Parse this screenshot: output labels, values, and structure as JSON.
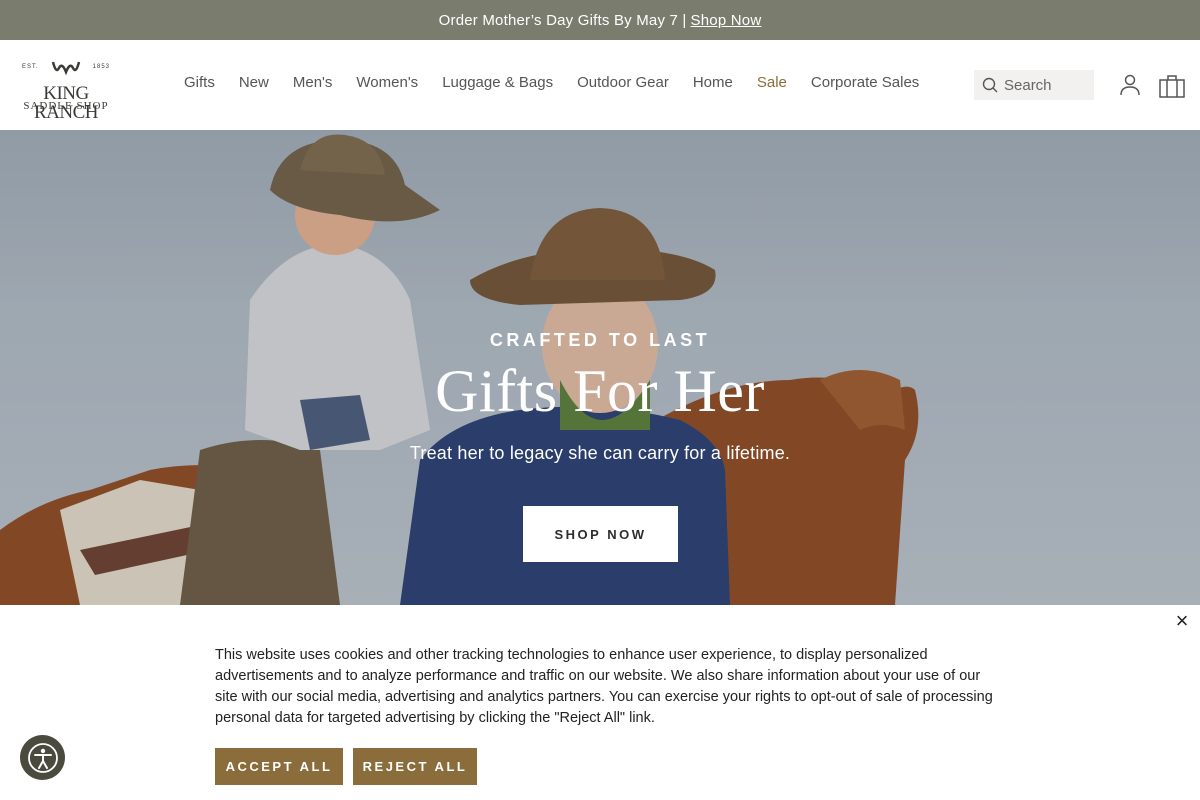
{
  "announcement": {
    "text": "Order Mother’s Day Gifts By May 7 |",
    "link": "Shop Now"
  },
  "logo": {
    "est_left": "EST.",
    "est_right": "1853",
    "line1": "KING RANCH",
    "line2": "SADDLE SHOP"
  },
  "nav": {
    "items": [
      "Gifts",
      "New",
      "Men's",
      "Women's",
      "Luggage & Bags",
      "Outdoor Gear",
      "Home",
      "Sale",
      "Corporate Sales"
    ]
  },
  "search": {
    "placeholder": "Search"
  },
  "icons": {
    "search": "search-icon",
    "account": "user-icon",
    "bag": "shopping-bag-icon",
    "close": "close-icon",
    "accessibility": "accessibility-icon"
  },
  "hero": {
    "eyebrow": "CRAFTED TO LAST",
    "title": "Gifts For Her",
    "subtitle": "Treat her to legacy she can carry for a lifetime.",
    "button": "SHOP NOW"
  },
  "cookie": {
    "text": "This website uses cookies and other tracking technologies to enhance user experience, to display personalized advertisements and to analyze performance and traffic on our website. We also share information about your use of our site with our social media, advertising and analytics partners. You can exercise your rights to opt-out of sale of processing personal data for targeted advertising by clicking the \"Reject All\" link.",
    "accept": "ACCEPT ALL",
    "reject": "REJECT ALL",
    "close": "×"
  },
  "colors": {
    "announcement_bg": "#7a7d6e",
    "brand_brown": "#8a6d3b",
    "sale": "#8a6d3b"
  }
}
